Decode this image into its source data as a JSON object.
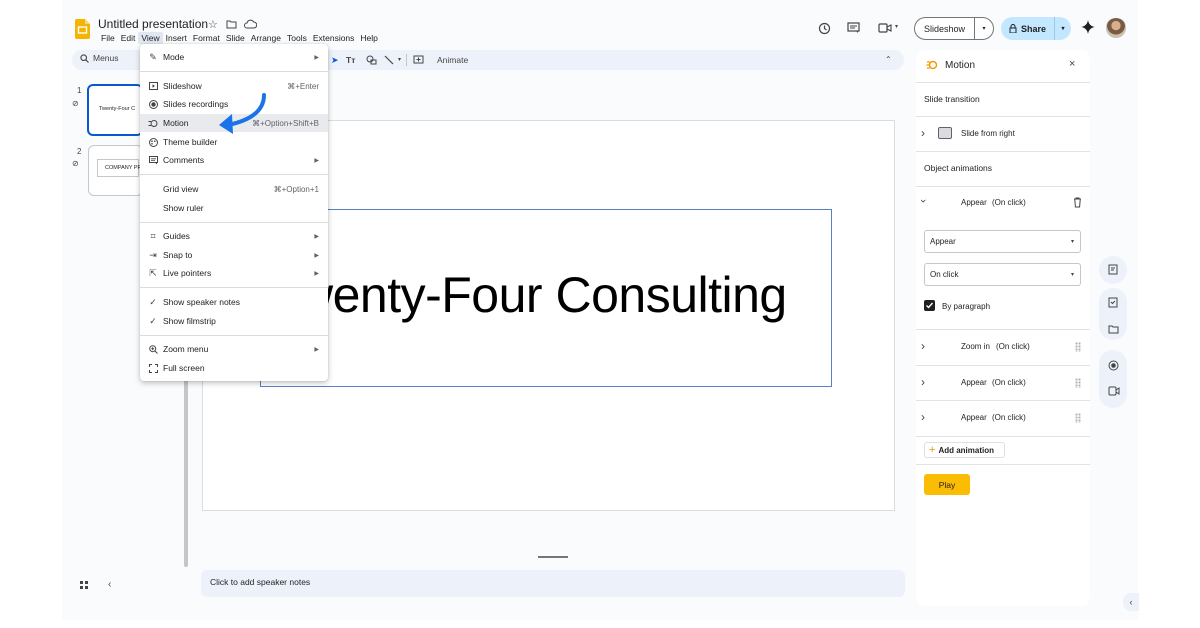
{
  "app": {
    "title": "Untitled presentation",
    "menu": [
      "File",
      "Edit",
      "View",
      "Insert",
      "Format",
      "Slide",
      "Arrange",
      "Tools",
      "Extensions",
      "Help"
    ],
    "active_menu": "View"
  },
  "header": {
    "slideshow_label": "Slideshow",
    "share_label": "Share"
  },
  "toolbar": {
    "menus_label": "Menus",
    "animate_label": "Animate"
  },
  "filmstrip": {
    "slides": [
      {
        "number": "1",
        "text": "Twenty-Four C"
      },
      {
        "number": "2",
        "text": "COMPANY PR"
      }
    ]
  },
  "slide": {
    "text": "wenty-Four Consulting"
  },
  "notes": {
    "placeholder": "Click to add speaker notes"
  },
  "view_menu": {
    "items": [
      {
        "label": "Mode",
        "icon": "pencil-icon",
        "shortcut": "",
        "submenu": true
      },
      {
        "label": "Slideshow",
        "icon": "slideshow-icon",
        "shortcut": "⌘+Enter",
        "submenu": false
      },
      {
        "label": "Slides recordings",
        "icon": "record-icon",
        "shortcut": "",
        "submenu": false
      },
      {
        "label": "Motion",
        "icon": "motion-icon",
        "shortcut": "⌘+Option+Shift+B",
        "submenu": false,
        "highlighted": true
      },
      {
        "label": "Theme builder",
        "icon": "palette-icon",
        "shortcut": "",
        "submenu": false
      },
      {
        "label": "Comments",
        "icon": "comment-icon",
        "shortcut": "",
        "submenu": true
      },
      {
        "label": "Grid view",
        "icon": "",
        "shortcut": "⌘+Option+1",
        "submenu": false
      },
      {
        "label": "Show ruler",
        "icon": "",
        "shortcut": "",
        "submenu": false
      },
      {
        "label": "Guides",
        "icon": "guides-icon",
        "shortcut": "",
        "submenu": true
      },
      {
        "label": "Snap to",
        "icon": "snap-icon",
        "shortcut": "",
        "submenu": true
      },
      {
        "label": "Live pointers",
        "icon": "pointer-icon",
        "shortcut": "",
        "submenu": true
      },
      {
        "label": "Show speaker notes",
        "icon": "check-icon",
        "shortcut": "",
        "submenu": false
      },
      {
        "label": "Show filmstrip",
        "icon": "check-icon",
        "shortcut": "",
        "submenu": false
      },
      {
        "label": "Zoom menu",
        "icon": "zoom-icon",
        "shortcut": "",
        "submenu": true
      },
      {
        "label": "Full screen",
        "icon": "fullscreen-icon",
        "shortcut": "",
        "submenu": false
      }
    ]
  },
  "motion_panel": {
    "title": "Motion",
    "slide_transition_heading": "Slide transition",
    "transition": "Slide from right",
    "object_animations_heading": "Object animations",
    "expanded_animation": {
      "effect": "Appear",
      "trigger": "(On click)"
    },
    "effect_select": "Appear",
    "trigger_select": "On click",
    "by_paragraph_label": "By paragraph",
    "by_paragraph_checked": true,
    "animations": [
      {
        "effect": "Zoom in",
        "trigger": "(On click)"
      },
      {
        "effect": "Appear",
        "trigger": "(On click)"
      },
      {
        "effect": "Appear",
        "trigger": "(On click)"
      }
    ],
    "add_animation_label": "Add animation",
    "play_label": "Play"
  },
  "colors": {
    "accent_blue": "#0b57d0",
    "share_bg": "#c2e7ff",
    "play_yellow": "#fbbc04",
    "annotation_arrow": "#1a73e8"
  }
}
